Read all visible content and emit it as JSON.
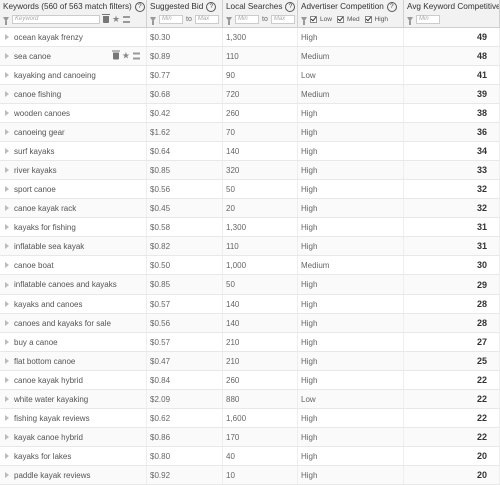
{
  "header": {
    "keywords_title": "Keywords (560 of 563 match filters)",
    "keyword_filter_placeholder": "Keyword",
    "bid_title": "Suggested Bid",
    "ls_title": "Local Searches",
    "ac_title": "Advertiser Competition",
    "avg_title": "Avg Keyword Competitiveness",
    "min_placeholder": "Min",
    "max_placeholder": "Max",
    "to_label": "to",
    "help_glyph": "?",
    "low_label": "Low",
    "med_label": "Med",
    "high_label": "High"
  },
  "rows": [
    {
      "keyword": "ocean kayak frenzy",
      "bid": "$0.30",
      "searches": "1,300",
      "competition": "High",
      "score": "49"
    },
    {
      "keyword": "sea canoe",
      "bid": "$0.89",
      "searches": "110",
      "competition": "Medium",
      "score": "48"
    },
    {
      "keyword": "kayaking and canoeing",
      "bid": "$0.77",
      "searches": "90",
      "competition": "Low",
      "score": "41"
    },
    {
      "keyword": "canoe fishing",
      "bid": "$0.68",
      "searches": "720",
      "competition": "Medium",
      "score": "39"
    },
    {
      "keyword": "wooden canoes",
      "bid": "$0.42",
      "searches": "260",
      "competition": "High",
      "score": "38"
    },
    {
      "keyword": "canoeing gear",
      "bid": "$1.62",
      "searches": "70",
      "competition": "High",
      "score": "36"
    },
    {
      "keyword": "surf kayaks",
      "bid": "$0.64",
      "searches": "140",
      "competition": "High",
      "score": "34"
    },
    {
      "keyword": "river kayaks",
      "bid": "$0.85",
      "searches": "320",
      "competition": "High",
      "score": "33"
    },
    {
      "keyword": "sport canoe",
      "bid": "$0.56",
      "searches": "50",
      "competition": "High",
      "score": "32"
    },
    {
      "keyword": "canoe kayak rack",
      "bid": "$0.45",
      "searches": "20",
      "competition": "High",
      "score": "32"
    },
    {
      "keyword": "kayaks for fishing",
      "bid": "$0.58",
      "searches": "1,300",
      "competition": "High",
      "score": "31"
    },
    {
      "keyword": "inflatable sea kayak",
      "bid": "$0.82",
      "searches": "110",
      "competition": "High",
      "score": "31"
    },
    {
      "keyword": "canoe boat",
      "bid": "$0.50",
      "searches": "1,000",
      "competition": "Medium",
      "score": "30"
    },
    {
      "keyword": "inflatable canoes and kayaks",
      "bid": "$0.85",
      "searches": "50",
      "competition": "High",
      "score": "29"
    },
    {
      "keyword": "kayaks and canoes",
      "bid": "$0.57",
      "searches": "140",
      "competition": "High",
      "score": "28"
    },
    {
      "keyword": "canoes and kayaks for sale",
      "bid": "$0.56",
      "searches": "140",
      "competition": "High",
      "score": "28"
    },
    {
      "keyword": "buy a canoe",
      "bid": "$0.57",
      "searches": "210",
      "competition": "High",
      "score": "27"
    },
    {
      "keyword": "flat bottom canoe",
      "bid": "$0.47",
      "searches": "210",
      "competition": "High",
      "score": "25"
    },
    {
      "keyword": "canoe kayak hybrid",
      "bid": "$0.84",
      "searches": "260",
      "competition": "High",
      "score": "22"
    },
    {
      "keyword": "white water kayaking",
      "bid": "$2.09",
      "searches": "880",
      "competition": "Low",
      "score": "22"
    },
    {
      "keyword": "fishing kayak reviews",
      "bid": "$0.62",
      "searches": "1,600",
      "competition": "High",
      "score": "22"
    },
    {
      "keyword": "kayak canoe hybrid",
      "bid": "$0.86",
      "searches": "170",
      "competition": "High",
      "score": "22"
    },
    {
      "keyword": "kayaks for lakes",
      "bid": "$0.80",
      "searches": "40",
      "competition": "High",
      "score": "20"
    },
    {
      "keyword": "paddle kayak reviews",
      "bid": "$0.92",
      "searches": "10",
      "competition": "High",
      "score": "20"
    }
  ]
}
